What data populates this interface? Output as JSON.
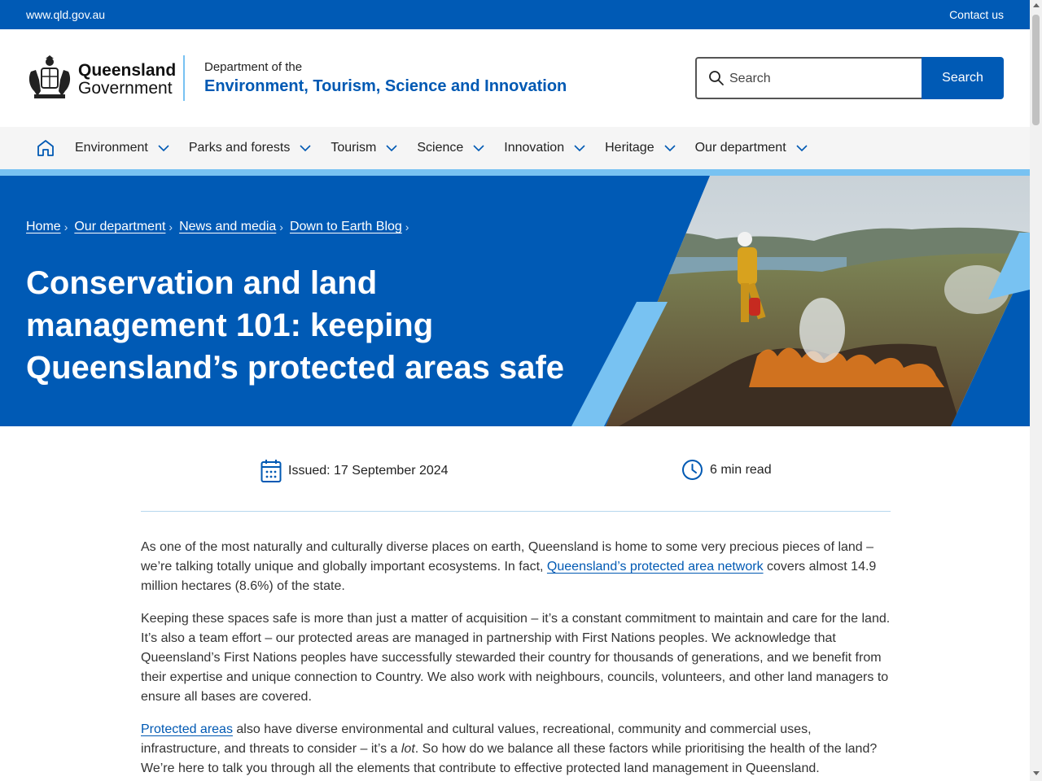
{
  "topbar": {
    "site_link": "www.qld.gov.au",
    "contact_link": "Contact us",
    "color": "#005ab5"
  },
  "header": {
    "logo": {
      "line1": "Queensland",
      "line2": "Government",
      "crest_icon": "queensland-coat-of-arms-icon"
    },
    "department": {
      "prefix": "Department of the",
      "name": "Environment, Tourism, Science and Innovation"
    },
    "search": {
      "placeholder": "Search",
      "value": "",
      "button_label": "Search",
      "icon": "search-icon"
    }
  },
  "nav": {
    "home_icon": "home-icon",
    "items": [
      {
        "label": "Environment"
      },
      {
        "label": "Parks and forests"
      },
      {
        "label": "Tourism"
      },
      {
        "label": "Science"
      },
      {
        "label": "Innovation"
      },
      {
        "label": "Heritage"
      },
      {
        "label": "Our department"
      }
    ]
  },
  "hero": {
    "breadcrumb": [
      {
        "label": "Home"
      },
      {
        "label": "Our department"
      },
      {
        "label": "News and media"
      },
      {
        "label": "Down to Earth Blog"
      }
    ],
    "title": "Conservation and land management 101: keeping Queensland’s protected areas safe",
    "image_description_icon": "firefighter-controlled-burn-photo"
  },
  "meta": {
    "issued": "Issued: 17 September 2024",
    "read_time": "6 min read",
    "calendar_icon": "calendar-icon",
    "clock_icon": "clock-icon"
  },
  "content": {
    "p1_before": "As one of the most naturally and culturally diverse places on earth, Queensland is home to some very precious pieces of land – we’re talking totally unique and globally important ecosystems. In fact, ",
    "p1_link": "Queensland’s protected area network",
    "p1_after": " covers almost 14.9 million hectares (8.6%) of the state.",
    "p2": "Keeping these spaces safe is more than just a matter of acquisition – it’s a constant commitment to maintain and care for the land. It’s also a team effort – our protected areas are managed in partnership with First Nations peoples. We acknowledge that Queensland’s First Nations peoples have successfully stewarded their country for thousands of generations, and we benefit from their expertise and unique connection to Country. We also work with neighbours, councils, volunteers, and other land managers to ensure all bases are covered.",
    "p3_link": "Protected areas",
    "p3_mid": " also have diverse environmental and cultural values, recreational, community and commercial uses, infrastructure, and threats to consider – it’s a ",
    "p3_em": "lot",
    "p3_after": ". So how do we balance all these factors while prioritising the health of the land? We’re here to talk you through all the elements that contribute to effective protected land management in Queensland."
  },
  "colors": {
    "brand_blue": "#005ab5",
    "accent_light_blue": "#78c2f2",
    "nav_bg": "#f5f5f5"
  }
}
